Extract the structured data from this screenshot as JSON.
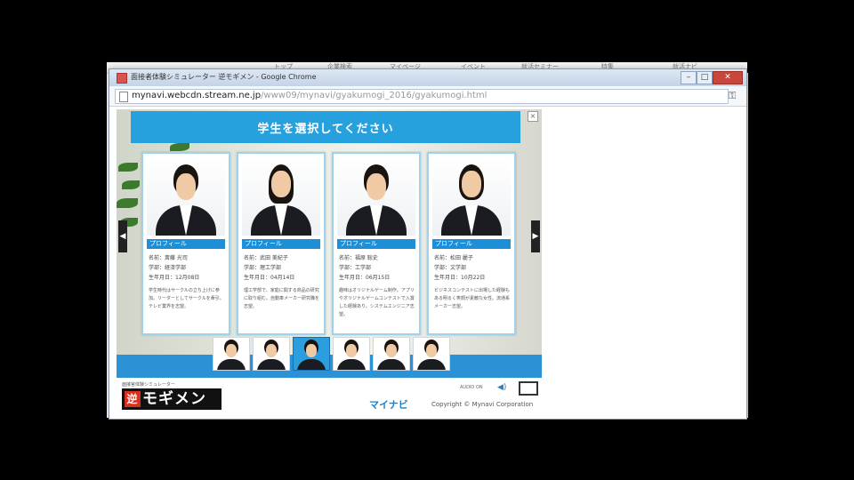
{
  "background_nav": {
    "items": [
      "トップ",
      "企業検索",
      "マイページ",
      "イベント",
      "就活セミナー",
      "特集",
      "就活ナビ"
    ]
  },
  "window": {
    "title": "面接者体験シミュレーター 逆モギメン - Google Chrome",
    "url_domain": "mynavi.webcdn.stream.ne.jp",
    "url_path": "/www09/mynavi/gyakumogi_2016/gyakumogi.html",
    "close_glyph": "✕",
    "min_glyph": "–",
    "max_glyph": "□"
  },
  "main": {
    "header": "学生を選択してください",
    "close_glyph": "×",
    "profile_label": "プロフィール",
    "arrows": {
      "left": "◀",
      "right": "▶"
    },
    "candidates": [
      {
        "name": "名前：斎藤 光司",
        "faculty": "学部：経済学部",
        "birthday": "生年月日：12月08日",
        "bio": "学生時代はサークルの立ち上げに参加。リーダーとしてサークルを牽引。テレビ業界を志望。"
      },
      {
        "name": "名前：武田 美紀子",
        "faculty": "学部：理工学部",
        "birthday": "生年月日：04月14日",
        "bio": "理工学部で、家庭に関する商品の研究に取り組む。自動車メーカー研究職を志望。"
      },
      {
        "name": "名前：福原 聡史",
        "faculty": "学部：工学部",
        "birthday": "生年月日：06月15日",
        "bio": "趣味はオリジナルゲーム制作。アプリやオリジナルゲームコンテストで入賞した経験あり。システムエンジニア志望。"
      },
      {
        "name": "名前：松田 麗子",
        "faculty": "学部：文学部",
        "birthday": "生年月日：10月22日",
        "bio": "ビジネスコンテストに出場した経験もある明るく笑顔が素敵な女性。流通系メーカー志望。"
      }
    ],
    "thumbnails": [
      {
        "label": "student-1",
        "selected": false
      },
      {
        "label": "student-2",
        "selected": false
      },
      {
        "label": "student-3",
        "selected": true
      },
      {
        "label": "student-4",
        "selected": false
      },
      {
        "label": "student-5",
        "selected": false
      },
      {
        "label": "student-6",
        "selected": false
      }
    ]
  },
  "footer": {
    "logo_small": "面接官体験シミュレーター",
    "logo_red": "逆",
    "logo_text": "モギメン",
    "audio_label": "AUDIO ON",
    "speaker_glyph": "◀)",
    "mynavi": "マイナビ",
    "copyright": "Copyright © Mynavi Corporation"
  }
}
